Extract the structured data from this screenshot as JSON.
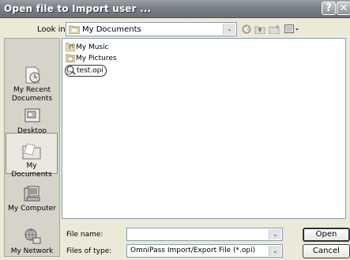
{
  "dialog": {
    "title": "Open file to Import user ...",
    "help_glyph": "?",
    "close_glyph": "✕"
  },
  "look_in": {
    "label": "Look in:",
    "value": "My Documents",
    "arrow": "⌄"
  },
  "nav_icons": [
    "back-icon",
    "up-folder-icon",
    "new-folder-icon",
    "view-menu-icon"
  ],
  "places": [
    {
      "label": "My Recent Documents",
      "icon": "recent-documents-icon"
    },
    {
      "label": "Desktop",
      "icon": "desktop-icon"
    },
    {
      "label": "My Documents",
      "icon": "my-documents-icon",
      "selected": true
    },
    {
      "label": "My Computer",
      "icon": "computer-icon"
    },
    {
      "label": "My Network",
      "icon": "network-icon"
    }
  ],
  "files": [
    {
      "name": "My Music",
      "icon": "music-folder-icon"
    },
    {
      "name": "My Pictures",
      "icon": "pictures-folder-icon"
    },
    {
      "name": "test.opi",
      "icon": "opi-file-icon",
      "circled": true
    }
  ],
  "file_name": {
    "label": "File name:",
    "value": "",
    "arrow": "⌄"
  },
  "file_type": {
    "label": "Files of type:",
    "value": "OmniPass Import/Export File (*.opi)",
    "arrow": "⌄"
  },
  "buttons": {
    "open": "Open",
    "cancel": "Cancel"
  },
  "colors": {
    "title_bar": "#7a8087",
    "dialog_bg": "#ece9d8",
    "places_bg": "#d6d3ca",
    "field_border": "#7f9db9"
  }
}
